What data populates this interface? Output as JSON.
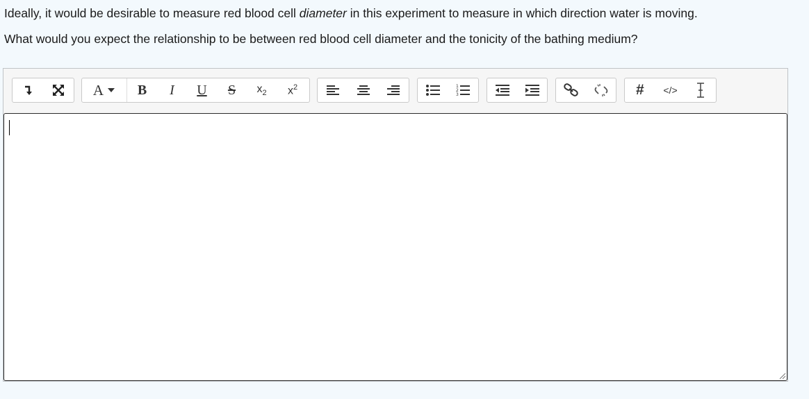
{
  "question": {
    "line1_before": "Ideally, it would be desirable to measure red blood cell ",
    "line1_em": "diameter",
    "line1_after": " in this experiment to measure in which direction water is moving.",
    "line2": "What would you expect the relationship to be between red blood cell diameter and the tonicity of the bathing medium?"
  },
  "toolbar": {
    "font_color_label": "A",
    "bold_label": "B",
    "italic_label": "I",
    "underline_label": "U",
    "strike_label": "S",
    "subscript_base": "x",
    "subscript_sup": "2",
    "superscript_base": "x",
    "superscript_sup": "2",
    "hash_label": "#",
    "code_label": "</>"
  },
  "editor": {
    "value": ""
  }
}
